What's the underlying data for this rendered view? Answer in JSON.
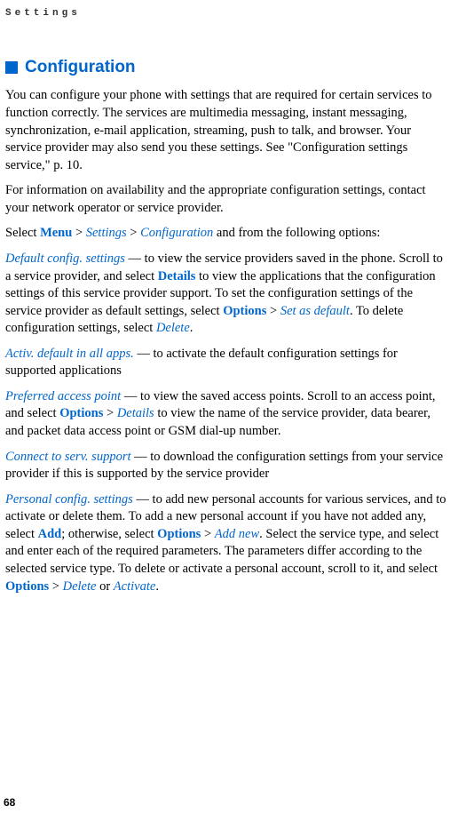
{
  "header": "Settings",
  "section": {
    "title": "Configuration"
  },
  "paragraphs": {
    "intro": "You can configure your phone with settings that are required for certain services to function correctly. The services are multimedia messaging, instant messaging, synchronization, e-mail application, streaming, push to talk, and browser. Your service provider may also send you these settings. See \"Configuration settings service,\" p. 10.",
    "info": "For information on availability and the appropriate configuration settings, contact your network operator or service provider.",
    "select_pre": "Select ",
    "menu": "Menu",
    "gt": " > ",
    "settings": "Settings",
    "configuration": "Configuration",
    "select_post": " and from the following options:",
    "default_config": "Default config. settings",
    "default_config_text1": " — to view the service providers saved in the phone. Scroll to a service provider, and select ",
    "details": "Details",
    "default_config_text2": " to view the applications that the configuration settings of this service provider support. To set the configuration settings of the service provider as default settings, select ",
    "options": "Options",
    "set_as_default": "Set as default",
    "default_config_text3": ". To delete configuration settings, select ",
    "delete": "Delete",
    "period": ".",
    "activ_default": "Activ. default in all apps.",
    "activ_default_text": " — to activate the default configuration settings for supported applications",
    "preferred_ap": "Preferred access point",
    "preferred_ap_text1": " — to view the saved access points. Scroll to an access point, and select ",
    "details2": "Details",
    "preferred_ap_text2": " to view the name of the service provider, data bearer, and packet data access point or GSM dial-up number.",
    "connect_serv": "Connect to serv. support",
    "connect_serv_text": " — to download the configuration settings from your service provider if this is supported by the service provider",
    "personal_config": "Personal config. settings",
    "personal_config_text1": " — to add new personal accounts for various services, and to activate or delete them. To add a new personal account if you have not added any, select ",
    "add": "Add",
    "personal_config_text2": "; otherwise, select ",
    "add_new": "Add new",
    "personal_config_text3": ". Select the service type, and select and enter each of the required parameters. The parameters differ according to the selected service type. To delete or activate a personal account, scroll to it, and select ",
    "or": " or ",
    "activate": "Activate"
  },
  "page_number": "68"
}
